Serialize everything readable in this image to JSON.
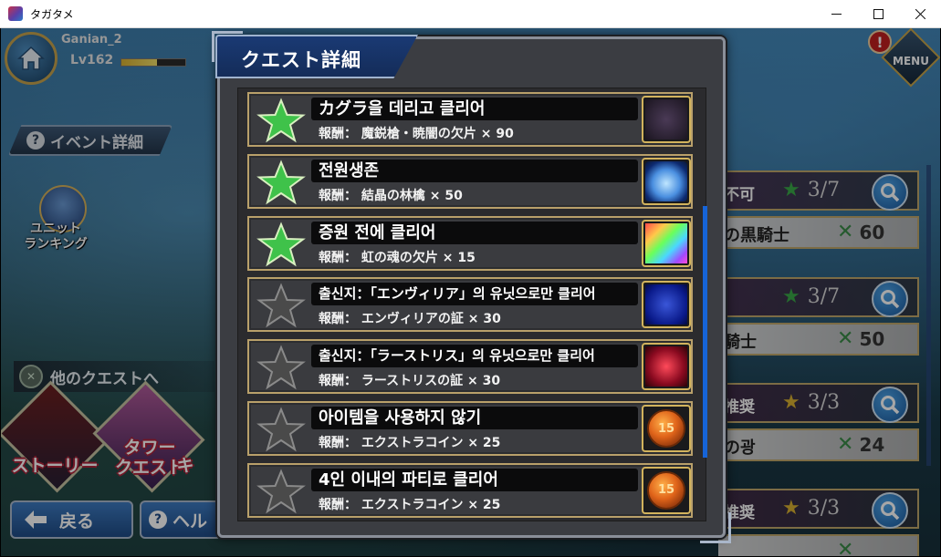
{
  "window": {
    "title": "タガタメ",
    "minimize_glyph": "—",
    "maximize_glyph": "☐",
    "close_glyph": "✕"
  },
  "hud": {
    "player_name": "Ganian_2",
    "level": "Lv162",
    "xp_fraction": 0.55,
    "event_detail_label": "イベント詳細",
    "ranking_label": "ユニット\nランキング",
    "other_quests_label": "他のクエストへ",
    "modes": [
      {
        "label": "ストーリー"
      },
      {
        "label": "タワー\nクエスト"
      },
      {
        "label": "キ"
      }
    ],
    "back_label": "戻る",
    "help_label": "ヘル",
    "menu_label": "MENU",
    "alert_glyph": "!"
  },
  "side_quests": [
    {
      "tag": "不可",
      "stars": "3/7",
      "star_color": "#3aa848",
      "name": "の黒騎士",
      "stamina": "60"
    },
    {
      "tag": "",
      "stars": "3/7",
      "star_color": "#3aa848",
      "name": "騎士",
      "stamina": "50"
    },
    {
      "tag": "推奨",
      "stars": "3/3",
      "star_color": "#d8b030",
      "name": "の광",
      "stamina": "24"
    },
    {
      "tag": "推奨",
      "stars": "3/3",
      "star_color": "#d8b030",
      "name": "",
      "stamina": ""
    }
  ],
  "modal": {
    "title": "クエスト詳細",
    "reward_prefix": "報酬：",
    "missions": [
      {
        "objective": "カグラ을 데리고 클리어",
        "reward": "魔鋭槍・暁闇の欠片 × 90",
        "achieved": true,
        "item_icon": "weapon-shard-icon"
      },
      {
        "objective": "전원생존",
        "reward": "結晶の林檎 × 50",
        "achieved": true,
        "item_icon": "crystal-apple-icon"
      },
      {
        "objective": "증원 전에 클리어",
        "reward": "虹の魂の欠片 × 15",
        "achieved": true,
        "item_icon": "rainbow-soul-shard-icon"
      },
      {
        "objective": "출신지：「エンヴィリア」의 유닛으로만 클리어",
        "reward": "エンヴィリアの証 × 30",
        "achieved": false,
        "item_icon": "envylia-emblem-icon"
      },
      {
        "objective": "출신지：「ラーストリス」의 유닛으로만 클리어",
        "reward": "ラーストリスの証 × 30",
        "achieved": false,
        "item_icon": "lastris-emblem-icon"
      },
      {
        "objective": "아이템을 사용하지 않기",
        "reward": "エクストラコイン × 25",
        "achieved": false,
        "item_icon": "extra-coin-icon"
      },
      {
        "objective": "4인 이내의 파티로 클리어",
        "reward": "エクストラコイン × 25",
        "achieved": false,
        "item_icon": "extra-coin-icon"
      }
    ]
  },
  "colors": {
    "star_achieved": "#3fc24a",
    "star_unachieved": "#4a4a4a",
    "frame_gold": "#b9a06a",
    "scrollbar": "#1664d8"
  }
}
